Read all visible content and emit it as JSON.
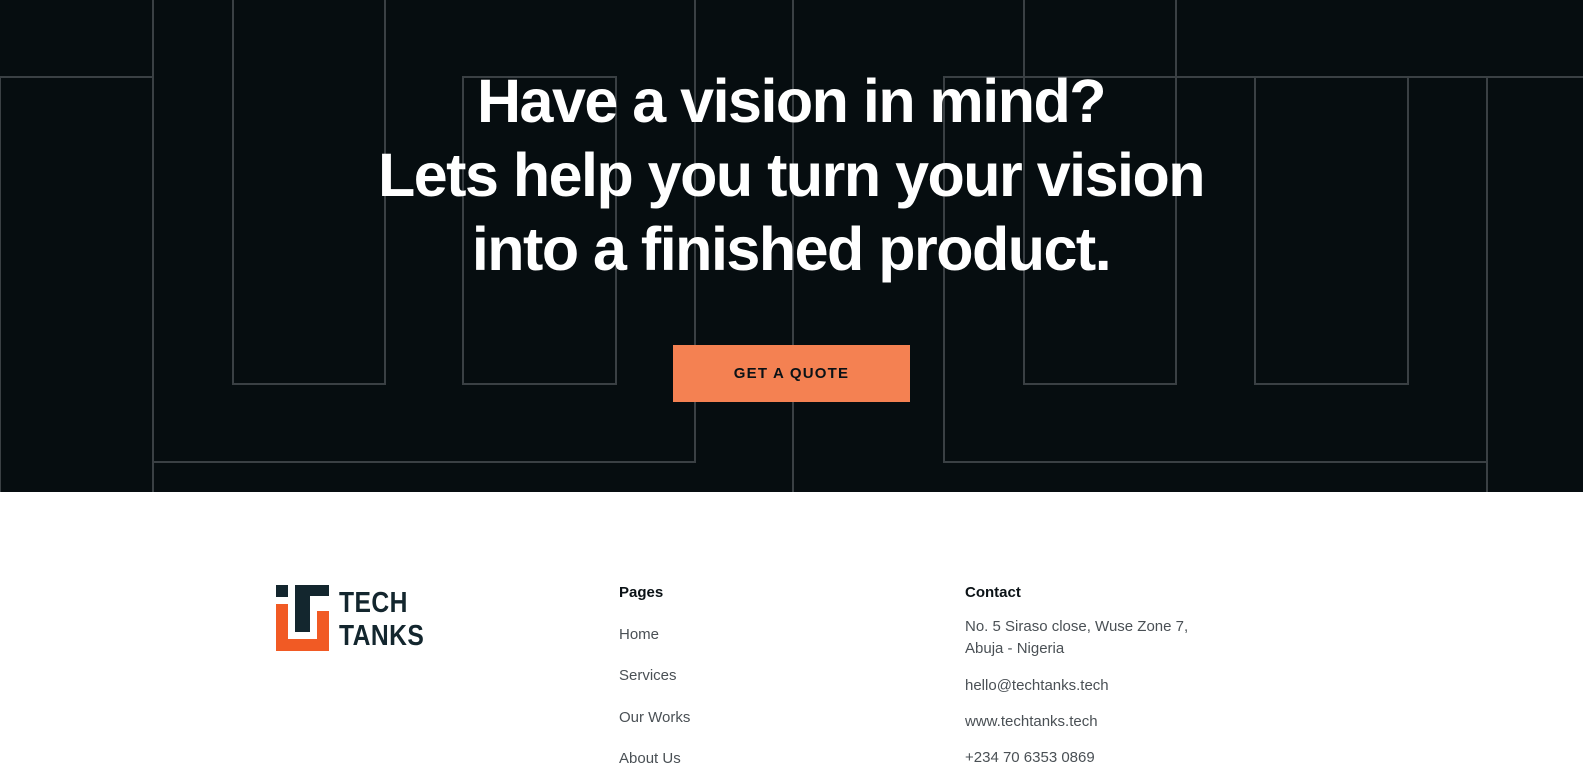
{
  "hero": {
    "title_lines": [
      "Have a vision in mind?",
      "Lets help you turn your vision",
      "into a finished product."
    ],
    "cta_label": "GET A QUOTE",
    "colors": {
      "background": "#060d10",
      "accent": "#f48152",
      "lines": "#3a4044"
    }
  },
  "footer": {
    "logo": {
      "line1": "TECH",
      "line2": "TANKS",
      "primary_color": "#13262e",
      "accent_color": "#f15a24"
    },
    "pages": {
      "title": "Pages",
      "links": [
        "Home",
        "Services",
        "Our Works",
        "About Us"
      ]
    },
    "contact": {
      "title": "Contact",
      "address_line1": "No. 5 Siraso close, Wuse Zone 7,",
      "address_line2": "Abuja - Nigeria",
      "email": "hello@techtanks.tech",
      "website": "www.techtanks.tech",
      "phone": "+234 70 6353 0869"
    }
  }
}
